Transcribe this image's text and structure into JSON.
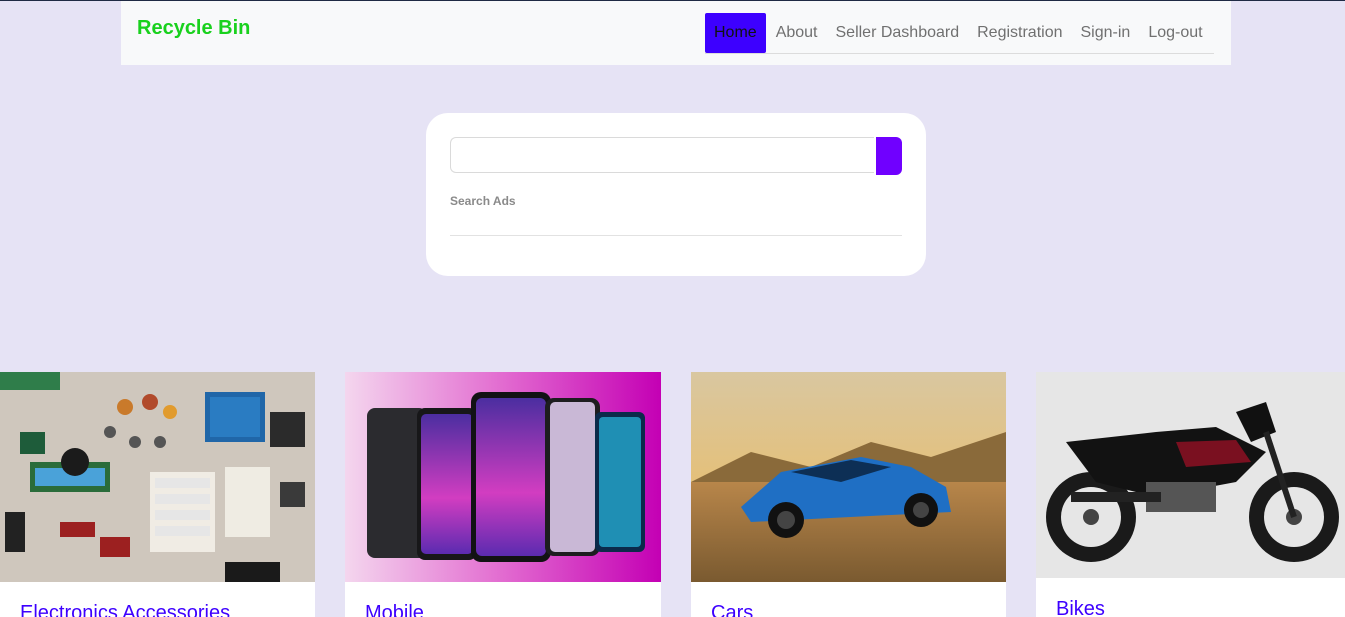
{
  "brand": "Recycle Bin",
  "nav": {
    "items": [
      {
        "label": "Home",
        "active": true
      },
      {
        "label": "About"
      },
      {
        "label": "Seller Dashboard"
      },
      {
        "label": "Registration"
      },
      {
        "label": "Sign-in"
      },
      {
        "label": "Log-out"
      }
    ]
  },
  "search": {
    "value": "",
    "label": "Search Ads",
    "button_color": "#7000ff"
  },
  "categories": [
    {
      "title": "Electronics Accessories",
      "icon": "electronics-image"
    },
    {
      "title": "Mobile",
      "icon": "mobile-phones-image"
    },
    {
      "title": "Cars",
      "icon": "blue-car-image"
    },
    {
      "title": "Bikes",
      "icon": "motorbike-image"
    }
  ],
  "colors": {
    "background": "#e6e3f5",
    "brand": "#19d11d",
    "accent": "#3d00ff"
  }
}
